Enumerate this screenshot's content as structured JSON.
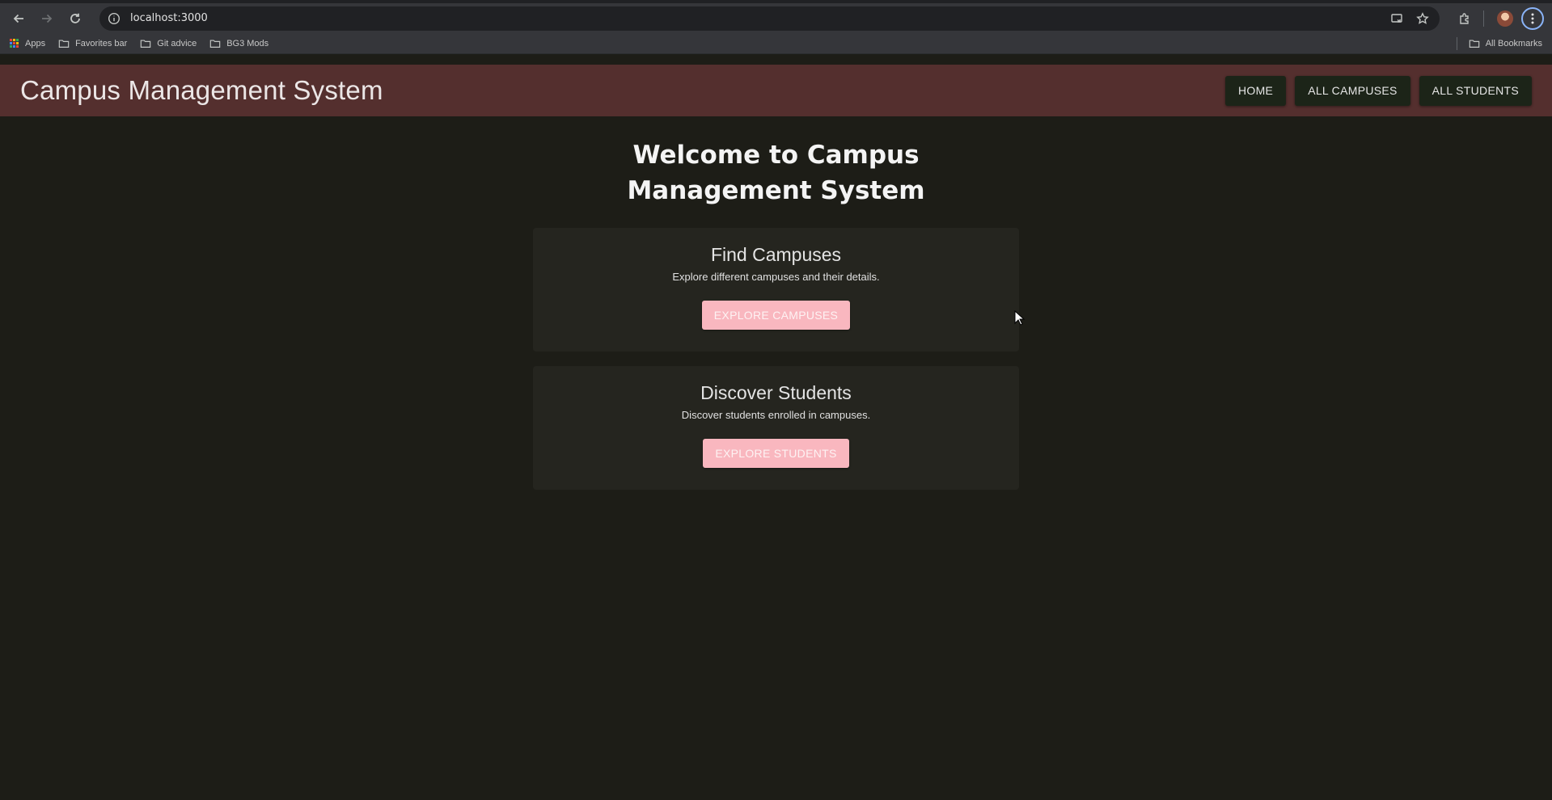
{
  "browser": {
    "url": "localhost:3000",
    "bookmarks": [
      {
        "label": "Apps",
        "icon": "apps-grid-icon"
      },
      {
        "label": "Favorites bar",
        "icon": "folder-icon"
      },
      {
        "label": "Git advice",
        "icon": "folder-icon"
      },
      {
        "label": "BG3 Mods",
        "icon": "folder-icon"
      }
    ],
    "all_bookmarks": "All Bookmarks"
  },
  "app": {
    "title": "Campus Management System",
    "nav": [
      {
        "label": "HOME"
      },
      {
        "label": "ALL CAMPUSES"
      },
      {
        "label": "ALL STUDENTS"
      }
    ],
    "colors": {
      "header_bg": "#542f2e",
      "page_bg": "#1d1d17",
      "nav_btn_bg": "#1c2418",
      "card_btn_bg": "#f9b7bf"
    }
  },
  "home": {
    "heading": "Welcome to Campus Management System",
    "cards": [
      {
        "title": "Find Campuses",
        "description": "Explore different campuses and their details.",
        "button": "EXPLORE CAMPUSES"
      },
      {
        "title": "Discover Students",
        "description": "Discover students enrolled in campuses.",
        "button": "EXPLORE STUDENTS"
      }
    ]
  }
}
